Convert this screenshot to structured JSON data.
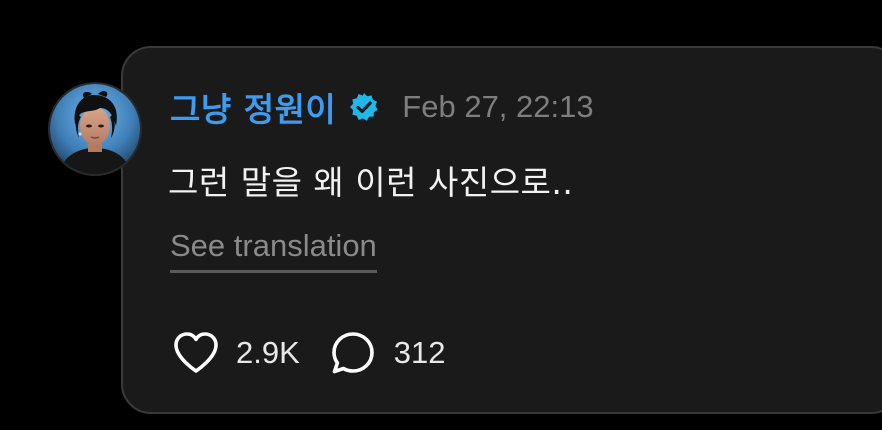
{
  "comment": {
    "author": "그냥 정원이",
    "verified": true,
    "timestamp": "Feb 27, 22:13",
    "text": "그런 말을 왜 이런 사진으로..",
    "translate_label": "See translation",
    "likes": "2.9K",
    "replies": "312"
  },
  "icons": {
    "verified": "verified-badge-icon",
    "like": "heart-icon",
    "reply": "speech-bubble-icon"
  },
  "colors": {
    "background": "#000000",
    "card": "#1a1a1a",
    "author": "#3d9bf0",
    "verified_badge": "#20b8e8",
    "muted": "#7e7e7e",
    "text": "#f2f2f2"
  }
}
